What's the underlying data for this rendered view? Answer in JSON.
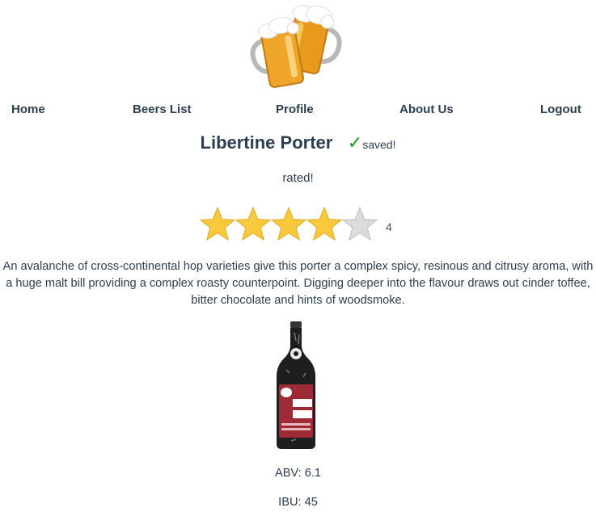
{
  "header": {
    "logo_icon": "beer-mugs-icon"
  },
  "nav": {
    "items": [
      {
        "label": "Home"
      },
      {
        "label": "Beers List"
      },
      {
        "label": "Profile"
      },
      {
        "label": "About Us"
      },
      {
        "label": "Logout"
      }
    ]
  },
  "beer": {
    "name": "Libertine Porter",
    "saved_mark": "✓",
    "saved_label": "saved!",
    "rated_label": "rated!",
    "rating": 4,
    "rating_max": 5,
    "rating_display": "4",
    "description": "An avalanche of cross-continental hop varieties give this porter a complex spicy, resinous and citrusy aroma, with a huge malt bill providing a complex roasty counterpoint. Digging deeper into the flavour draws out cinder toffee, bitter chocolate and hints of woodsmoke.",
    "image_icon": "beer-bottle-icon",
    "abv": "ABV: 6.1",
    "ibu": "IBU: 45"
  },
  "colors": {
    "star_filled": "#f8c93c",
    "star_empty": "#dcdcdc",
    "check": "#1a9c1a",
    "text": "#2c3e50"
  }
}
